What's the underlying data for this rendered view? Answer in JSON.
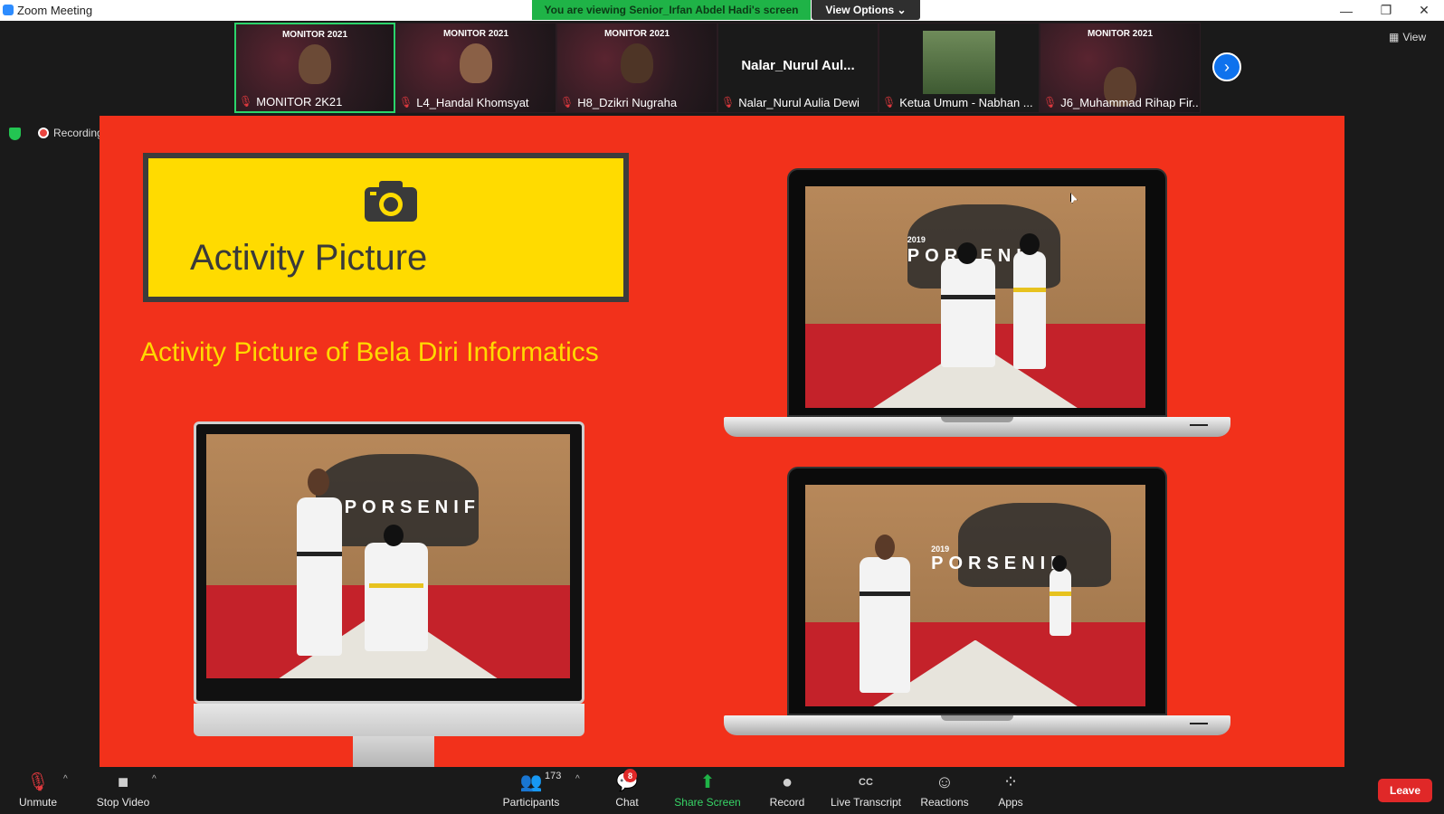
{
  "window": {
    "title": "Zoom Meeting",
    "minimize": "—",
    "restore": "❐",
    "close": "✕"
  },
  "banner": {
    "text": "You are viewing Senior_Irfan Abdel Hadi's screen",
    "view_options": "View Options ⌄"
  },
  "gallery": {
    "tiles": [
      {
        "name": "MONITOR 2K21",
        "overlay": "MONITOR 2021",
        "active": true
      },
      {
        "name": "L4_Handal Khomsyat",
        "overlay": "MONITOR 2021"
      },
      {
        "name": "H8_Dzikri Nugraha",
        "overlay": "MONITOR 2021"
      },
      {
        "name": "Nalar_Nurul Aulia Dewi",
        "big": "Nalar_Nurul  Aul..."
      },
      {
        "name": "Ketua Umum - Nabhan ..."
      },
      {
        "name": "J6_Muhammad Rihap Fir...",
        "overlay": "MONITOR 2021"
      }
    ],
    "next": "›",
    "view_label": "View"
  },
  "status": {
    "recording": "Recording"
  },
  "slide": {
    "box_title": "Activity Picture",
    "subtitle": "Activity Picture of Bela Diri Informatics",
    "photo_logo": "PORSENIF",
    "photo_year": "2019"
  },
  "toolbar": {
    "unmute": "Unmute",
    "stop_video": "Stop Video",
    "participants": "Participants",
    "participants_count": "173",
    "chat": "Chat",
    "chat_badge": "8",
    "share": "Share Screen",
    "record": "Record",
    "transcript": "Live Transcript",
    "transcript_icon": "CC",
    "reactions": "Reactions",
    "apps": "Apps",
    "leave": "Leave"
  },
  "colors": {
    "slide_bg": "#f2311b",
    "title_box": "#ffdb00",
    "share_green": "#1fb347",
    "leave_red": "#e02828"
  }
}
